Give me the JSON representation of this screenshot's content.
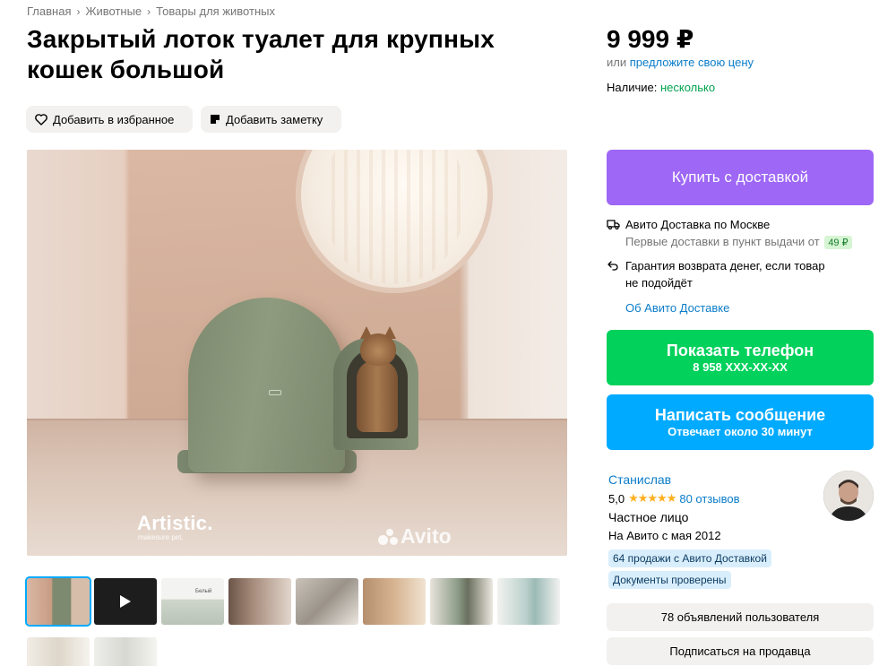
{
  "breadcrumbs": [
    "Главная",
    "Животные",
    "Товары для животных"
  ],
  "title": "Закрытый лоток туалет для крупных кошек большой",
  "actions": {
    "favorite": "Добавить в избранное",
    "note": "Добавить заметку"
  },
  "photo": {
    "brand": "Artistic.",
    "brand_sub": "makesure pet.",
    "watermark": "Avito"
  },
  "thumbnails": [
    "photo-1",
    "video",
    "photo-3",
    "photo-4",
    "photo-5",
    "photo-6",
    "photo-7",
    "photo-8",
    "photo-9",
    "photo-10"
  ],
  "thumb_label_3": "Белый",
  "price": "9 999 ₽",
  "offer": {
    "prefix": "или",
    "link": "предложите свою цену"
  },
  "availability": {
    "label": "Наличие:",
    "value": "несколько"
  },
  "buy_button": "Купить с доставкой",
  "delivery": {
    "title": "Авито Доставка по Москве",
    "first": "Первые доставки в пункт выдачи от",
    "first_price": "49 ₽",
    "guarantee_line1": "Гарантия возврата денег, если товар",
    "guarantee_line2": "не подойдёт",
    "about_link": "Об Авито Доставке"
  },
  "phone_button": {
    "label": "Показать телефон",
    "number": "8 958 XXX-XX-XX"
  },
  "message_button": {
    "label": "Написать сообщение",
    "sub": "Отвечает около 30 минут"
  },
  "seller": {
    "name": "Станислав",
    "rating": "5,0",
    "stars": "★★★★★",
    "reviews": "80 отзывов",
    "type": "Частное лицо",
    "since": "На Авито с мая 2012",
    "badge_sales": "64 продажи с Авито Доставкой",
    "badge_docs": "Документы проверены"
  },
  "listings_button": "78 объявлений пользователя",
  "subscribe_button": "Подписаться на продавца",
  "colors": {
    "buy": "#9e67f6",
    "phone": "#02d15c",
    "message": "#00aaff",
    "link": "#0a7cc9",
    "available": "#02a350",
    "star": "#ffb021"
  }
}
